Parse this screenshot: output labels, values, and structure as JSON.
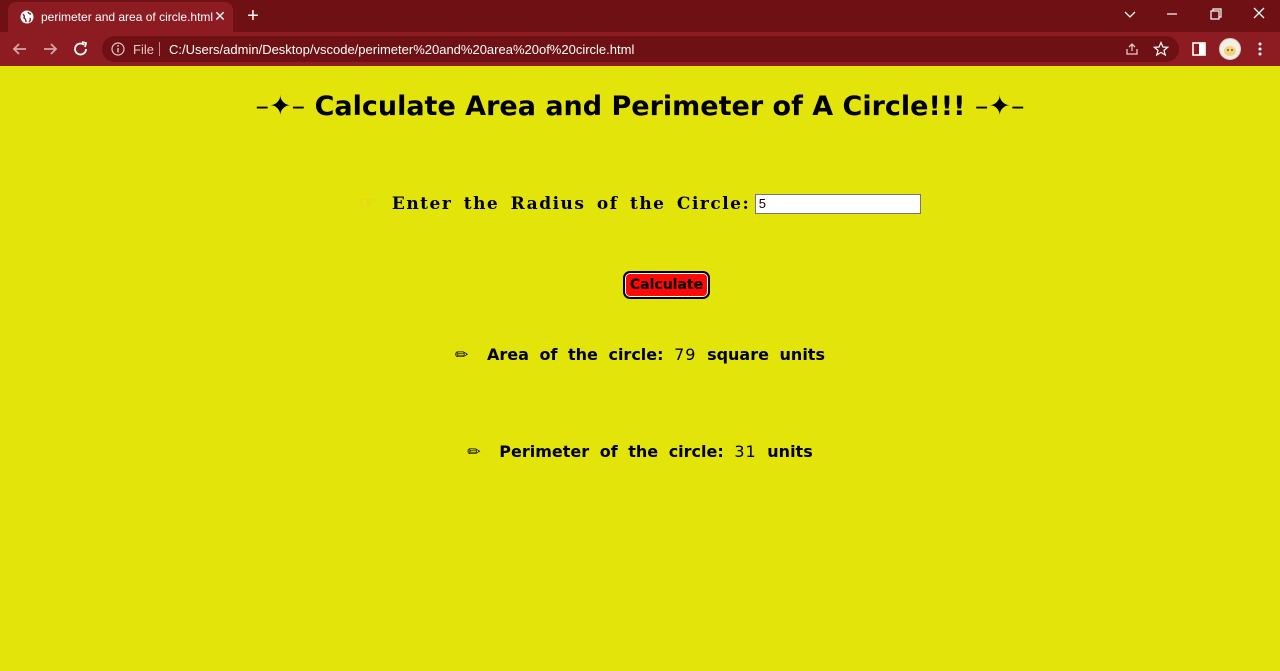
{
  "browser": {
    "tab_title": "perimeter and area of circle.html",
    "file_label": "File",
    "url": "C:/Users/admin/Desktop/vscode/perimeter%20and%20area%20of%20circle.html"
  },
  "page": {
    "heading_prefix": "–✦–",
    "heading": "Calculate Area and Perimeter of A Circle!!!",
    "heading_suffix": "–✦–",
    "radius_label": "Enter the Radius of the Circle:",
    "radius_value": "5",
    "calculate_label": "Calculate",
    "area_label": "Area of the circle:",
    "area_value": "79",
    "area_unit": "square units",
    "perimeter_label": "Perimeter of the circle:",
    "perimeter_value": "31",
    "perimeter_unit": "units"
  },
  "colors": {
    "page_background": "#e2e40a",
    "button_background": "#ff0808",
    "browser_frame": "#6e1014"
  },
  "icons": {
    "hand": "pointing-hand-icon",
    "pencil": "pencil-icon"
  }
}
